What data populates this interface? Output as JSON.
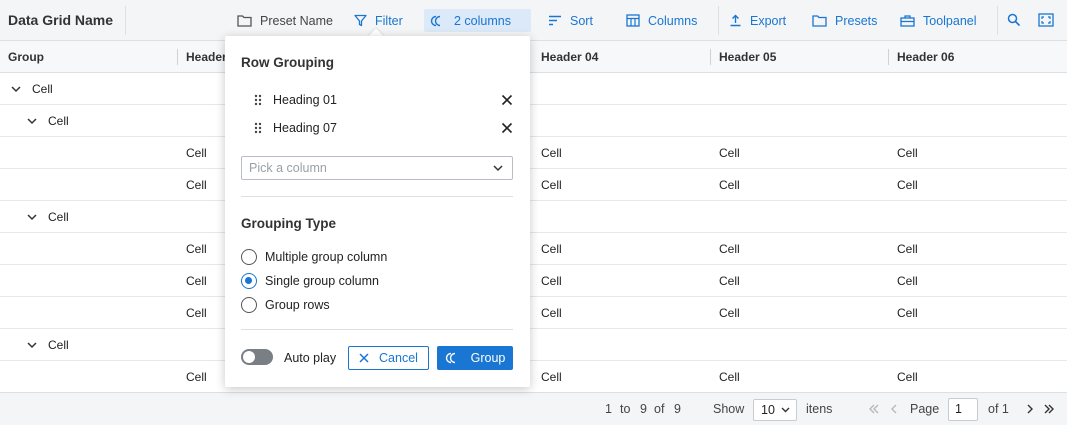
{
  "toolbar": {
    "title": "Data Grid Name",
    "preset_name": "Preset Name",
    "filter": "Filter",
    "grouping": "2 columns",
    "sort": "Sort",
    "columns": "Columns",
    "export": "Export",
    "presets": "Presets",
    "toolpanel": "Toolpanel"
  },
  "grid": {
    "headers": [
      "Group",
      "Header",
      "Header 04",
      "Header 05",
      "Header 06"
    ],
    "group_label": "Cell",
    "data_cell": "Cell"
  },
  "footer": {
    "range_from": "1",
    "to_word": "to",
    "range_to": "9",
    "of_word": "of",
    "total": "9",
    "show_label": "Show",
    "page_size": "10",
    "items_label": "itens",
    "page_label": "Page",
    "page_value": "1",
    "page_of": "of 1"
  },
  "popup": {
    "row_grouping_title": "Row Grouping",
    "grouped_columns": [
      "Heading 01",
      "Heading 07"
    ],
    "pick_placeholder": "Pick a column",
    "grouping_type_title": "Grouping Type",
    "options": [
      "Multiple group column",
      "Single group column",
      "Group rows"
    ],
    "selected_option": "Single group column",
    "auto_play_label": "Auto play",
    "auto_play_on": false,
    "cancel_label": "Cancel",
    "group_label": "Group"
  },
  "colors": {
    "accent": "#1976d2",
    "toolbar_bg": "#f4f5f7",
    "active_bg": "#dbe9f8"
  }
}
